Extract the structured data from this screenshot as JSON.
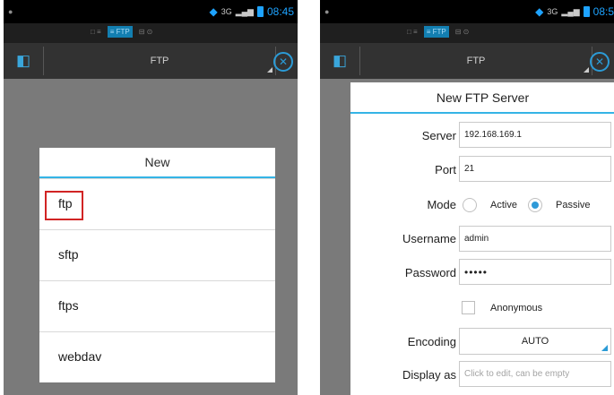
{
  "left_screen": {
    "status": {
      "time": "08:45",
      "network": "3G"
    },
    "tabs": [
      "□ ≡",
      "≡ FTP",
      "⊟ ⊙"
    ],
    "toolbar": {
      "title": "FTP"
    },
    "dialog": {
      "title": "New",
      "options": [
        "ftp",
        "sftp",
        "ftps",
        "webdav"
      ],
      "highlighted_option": "ftp"
    }
  },
  "right_screen": {
    "status": {
      "time": "08:5",
      "network": "3G"
    },
    "tabs": [
      "□ ≡",
      "≡ FTP",
      "⊟ ⊙"
    ],
    "toolbar": {
      "title": "FTP"
    },
    "dialog": {
      "title": "New FTP Server",
      "server": {
        "label": "Server",
        "value": "192.168.169.1"
      },
      "port": {
        "label": "Port",
        "value": "21"
      },
      "mode": {
        "label": "Mode",
        "active_label": "Active",
        "passive_label": "Passive",
        "selected": "Passive"
      },
      "username": {
        "label": "Username",
        "value": "admin"
      },
      "password": {
        "label": "Password",
        "value": "•••••"
      },
      "anonymous": {
        "label": "Anonymous",
        "checked": false
      },
      "encoding": {
        "label": "Encoding",
        "value": "AUTO"
      },
      "display_as": {
        "label": "Display as",
        "placeholder": "Click to edit, can be empty"
      }
    }
  },
  "colors": {
    "accent": "#35b4e6",
    "highlight_box": "#d12424",
    "dim_background": "#7a7a7a",
    "toolbar": "#323232"
  },
  "icons": {
    "toolbar_left": "sidebar-icon",
    "toolbar_right": "close-icon",
    "status_wifi": "wifi-icon",
    "status_battery": "battery-icon"
  }
}
